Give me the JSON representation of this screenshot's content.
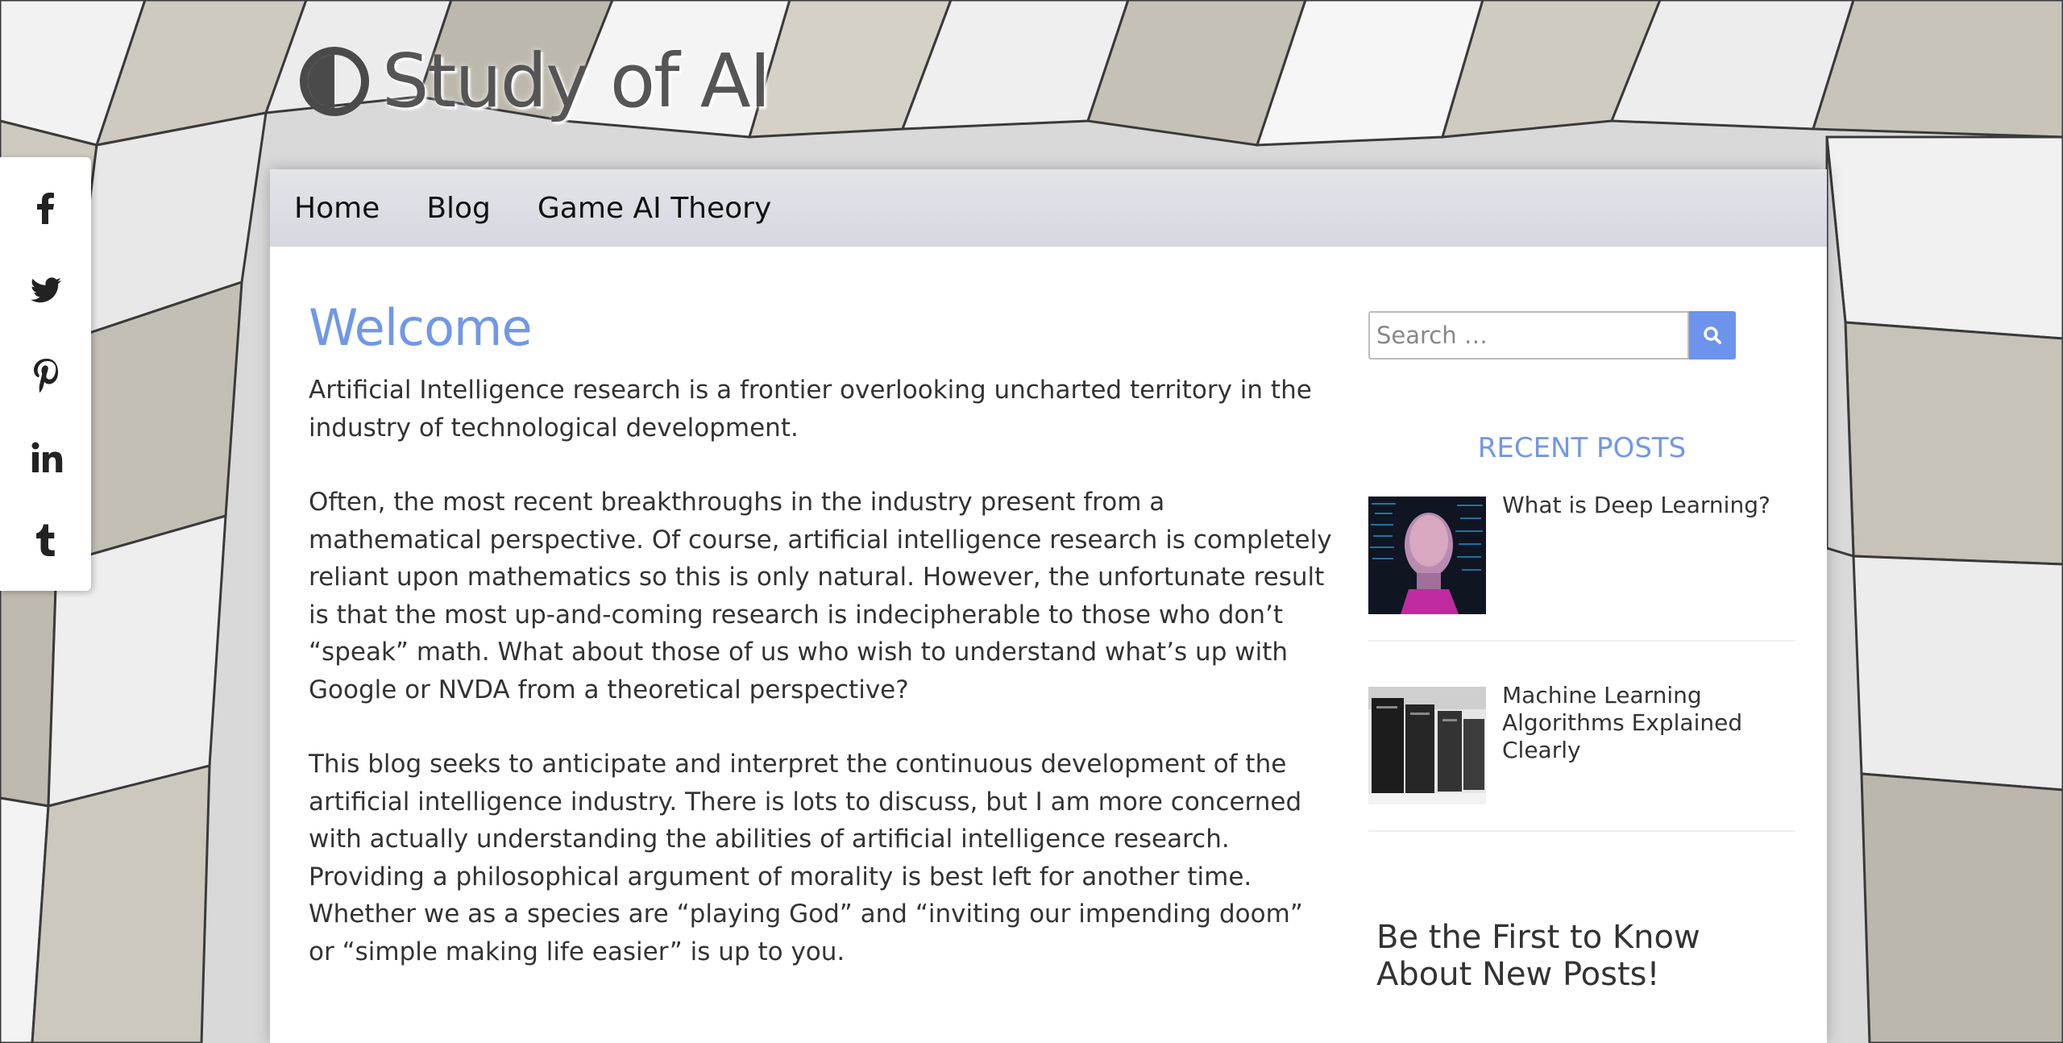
{
  "site": {
    "title": "Study of AI"
  },
  "social": [
    "facebook",
    "twitter",
    "pinterest",
    "linkedin",
    "tumblr"
  ],
  "nav": {
    "items": [
      {
        "label": "Home"
      },
      {
        "label": "Blog"
      },
      {
        "label": "Game AI Theory"
      }
    ]
  },
  "main": {
    "title": "Welcome",
    "paragraphs": [
      "Artificial Intelligence research is a frontier overlooking uncharted territory in the industry of technological development.",
      "Often, the most recent breakthroughs in the industry present from a mathematical perspective. Of course, artificial intelligence research is completely reliant upon mathematics so this is only natural. However, the unfortunate result is that the most up-and-coming research is indecipherable to those who don’t “speak” math. What about those of us who wish to understand what’s up with Google or NVDA from a theoretical perspective?",
      "This blog seeks to anticipate and interpret the continuous development of the artificial intelligence industry. There is lots to discuss, but I am more concerned with actually understanding the abilities of artificial intelligence research. Providing a philosophical argument of morality is best left for another time. Whether we as a species are “playing God” and “inviting our impending doom” or “simple making life easier” is up to you."
    ]
  },
  "sidebar": {
    "search": {
      "placeholder": "Search …",
      "icon": "search-icon"
    },
    "recent_title": "RECENT POSTS",
    "posts": [
      {
        "title": "What is Deep Learning?"
      },
      {
        "title": "Machine Learning Algorithms Explained Clearly"
      }
    ],
    "subscribe_title": "Be the First to Know About New Posts!"
  },
  "colors": {
    "accent": "#7197e8",
    "button": "#6d93ec",
    "text": "#333333"
  }
}
